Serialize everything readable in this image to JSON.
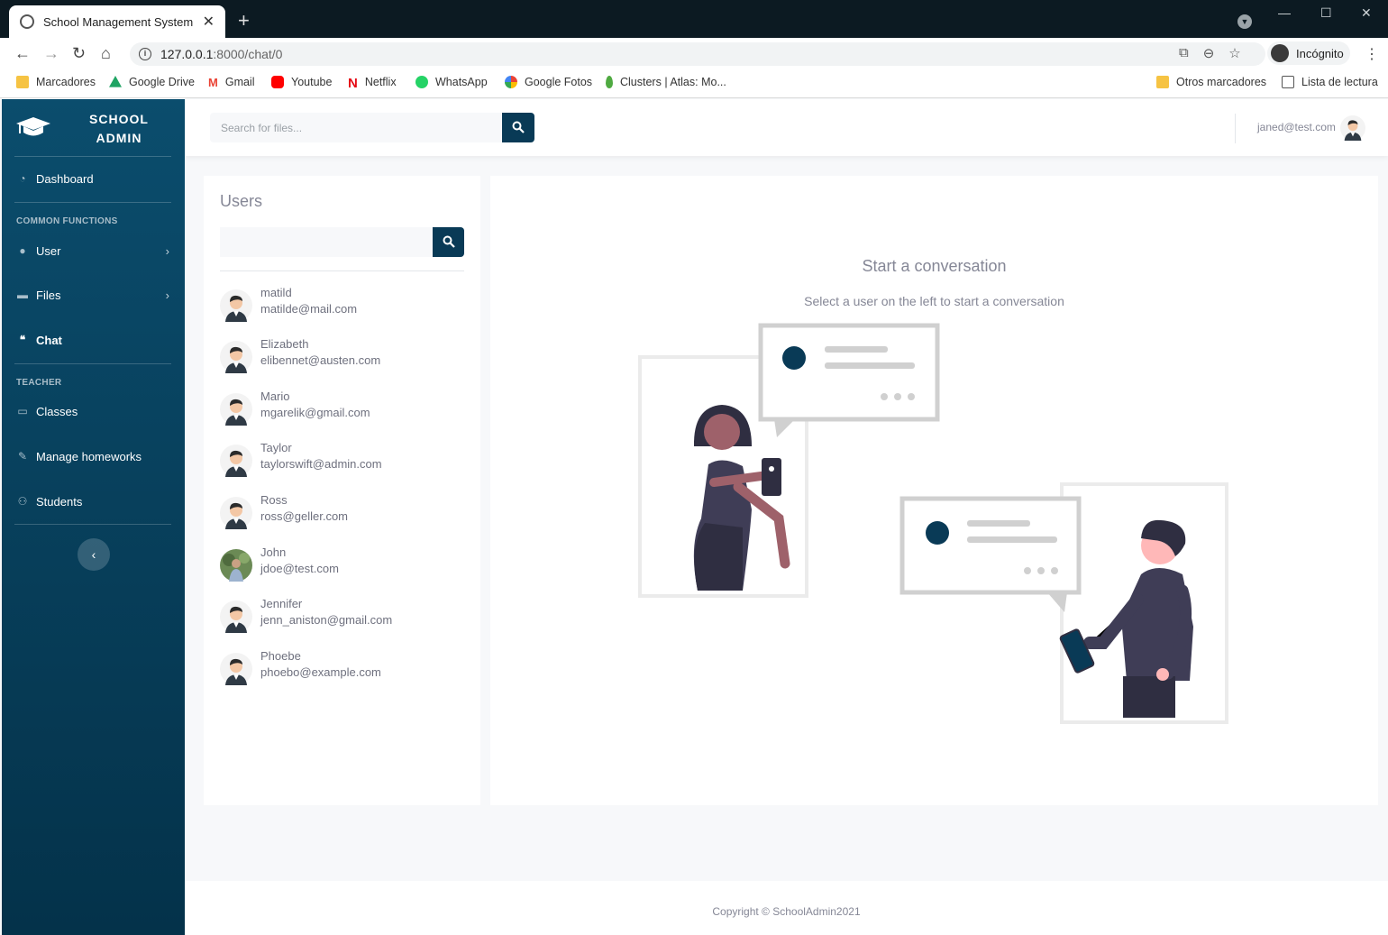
{
  "browser": {
    "tab_title": "School Management System",
    "url_host": "127.0.0.1",
    "url_path": ":8000/chat/0",
    "incognito_label": "Incógnito",
    "bookmarks": [
      {
        "label": "Marcadores",
        "icon": "folder-icon",
        "color": "#f6c343"
      },
      {
        "label": "Google Drive",
        "icon": "drive-icon",
        "color": "#1fa463"
      },
      {
        "label": "Gmail",
        "icon": "gmail-icon",
        "color": "#ea4335"
      },
      {
        "label": "Youtube",
        "icon": "youtube-icon",
        "color": "#ff0000"
      },
      {
        "label": "Netflix",
        "icon": "netflix-icon",
        "color": "#e50914"
      },
      {
        "label": "WhatsApp",
        "icon": "whatsapp-icon",
        "color": "#25d366"
      },
      {
        "label": "Google Fotos",
        "icon": "photos-icon",
        "color": "#fbbc04"
      },
      {
        "label": "Clusters | Atlas: Mo...",
        "icon": "mongodb-icon",
        "color": "#4faa41"
      }
    ],
    "other_bookmarks": "Otros marcadores",
    "reading_list": "Lista de lectura"
  },
  "sidebar": {
    "brand_line1": "SCHOOL",
    "brand_line2": "ADMIN",
    "dashboard": "Dashboard",
    "section_common": "COMMON FUNCTIONS",
    "user": "User",
    "files": "Files",
    "chat": "Chat",
    "section_teacher": "TEACHER",
    "classes": "Classes",
    "manage_homeworks": "Manage homeworks",
    "students": "Students"
  },
  "topbar": {
    "search_placeholder": "Search for files...",
    "user_email": "janed@test.com"
  },
  "users": {
    "title": "Users",
    "list": [
      {
        "name": "matild",
        "email": "matilde@mail.com"
      },
      {
        "name": "Elizabeth",
        "email": "elibennet@austen.com"
      },
      {
        "name": "Mario",
        "email": "mgarelik@gmail.com"
      },
      {
        "name": "Taylor",
        "email": "taylorswift@admin.com"
      },
      {
        "name": "Ross",
        "email": "ross@geller.com"
      },
      {
        "name": "John",
        "email": "jdoe@test.com"
      },
      {
        "name": "Jennifer",
        "email": "jenn_aniston@gmail.com"
      },
      {
        "name": "Phoebe",
        "email": "phoebo@example.com"
      }
    ]
  },
  "chat": {
    "title": "Start a conversation",
    "subtitle": "Select a user on the left to start a conversation"
  },
  "footer": {
    "copyright": "Copyright © SchoolAdmin2021"
  },
  "colors": {
    "primary": "#093a56",
    "sidebar_top": "#0b4d6d",
    "sidebar_bottom": "#04324a",
    "text_muted": "#858796"
  }
}
